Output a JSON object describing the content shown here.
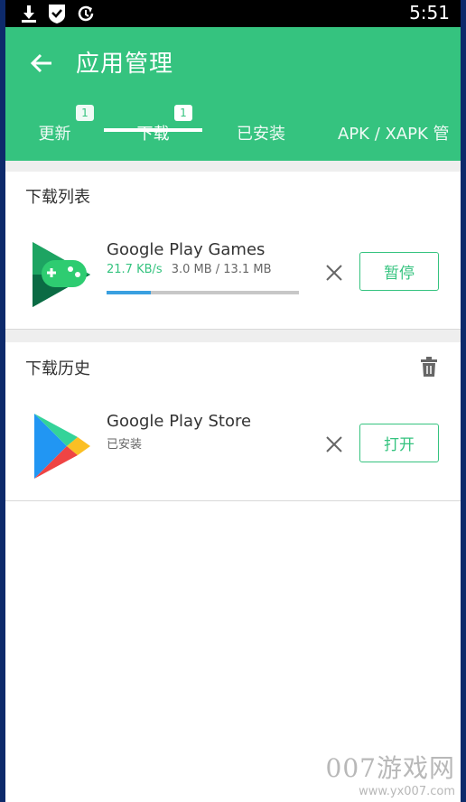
{
  "status_bar": {
    "time": "5:51",
    "icons": [
      "download-icon",
      "shield-check-icon",
      "sync-icon"
    ]
  },
  "app_bar": {
    "title": "应用管理",
    "back_icon": "arrow-left-icon"
  },
  "tabs": [
    {
      "label": "更新",
      "badge": "1"
    },
    {
      "label": "下载",
      "badge": "1",
      "active": true
    },
    {
      "label": "已安装"
    },
    {
      "label": "APK / XAPK 管"
    }
  ],
  "download_list": {
    "header": "下载列表",
    "items": [
      {
        "name": "Google Play Games",
        "speed": "21.7 KB/s",
        "size": "3.0 MB / 13.1 MB",
        "progress": 0.23,
        "action": "暂停"
      }
    ]
  },
  "download_history": {
    "header": "下载历史",
    "items": [
      {
        "name": "Google Play Store",
        "status": "已安装",
        "action": "打开"
      }
    ]
  },
  "watermark": {
    "brand": "007游戏网",
    "url": "www.yx007.com"
  },
  "colors": {
    "accent": "#35c37f",
    "progress": "#3aa0e0",
    "frame": "#0d2a6b"
  }
}
